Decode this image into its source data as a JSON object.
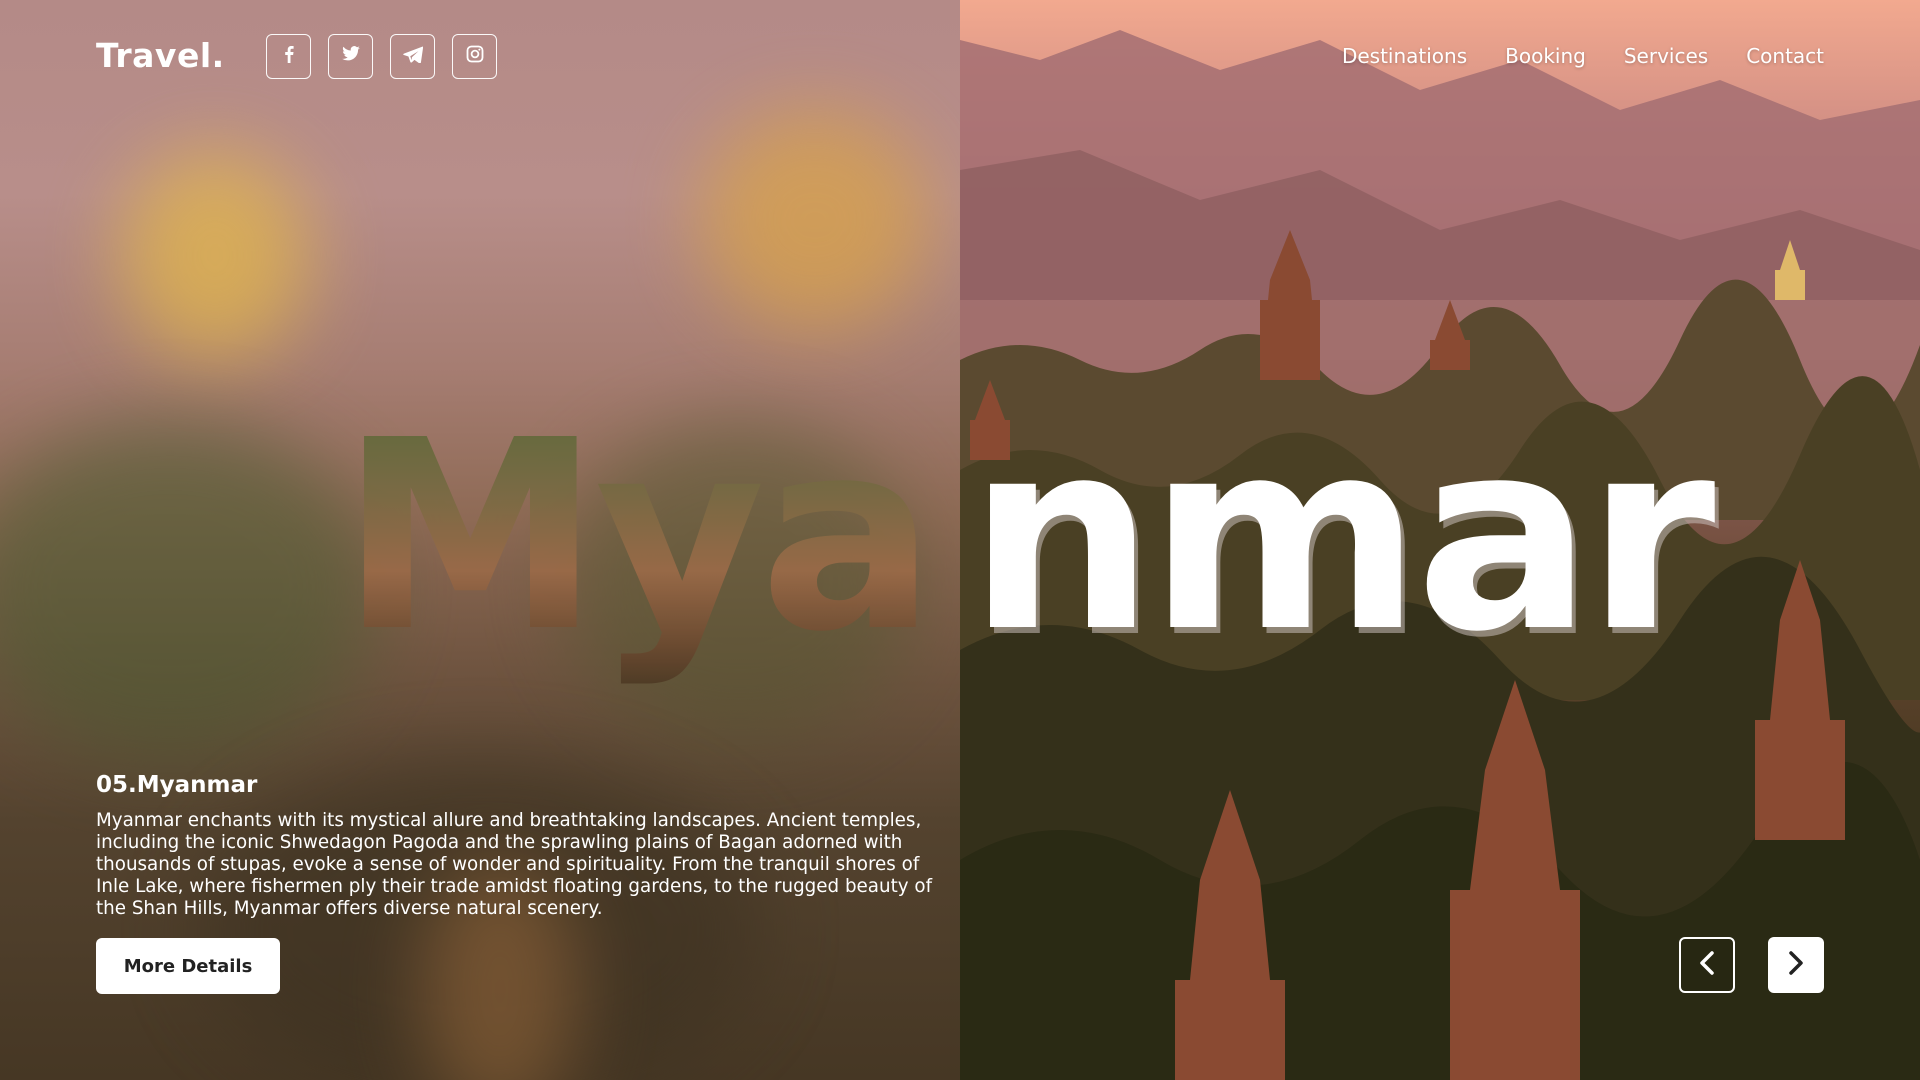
{
  "brand": {
    "logo": "Travel."
  },
  "socials": [
    {
      "name": "facebook",
      "icon": "facebook-icon"
    },
    {
      "name": "twitter",
      "icon": "twitter-icon"
    },
    {
      "name": "telegram",
      "icon": "telegram-icon"
    },
    {
      "name": "instagram",
      "icon": "instagram-icon"
    }
  ],
  "nav": {
    "items": [
      "Destinations",
      "Booking",
      "Services",
      "Contact"
    ]
  },
  "hero": {
    "word_left": "Mya",
    "word_right": "nmar"
  },
  "destination": {
    "title": "05.Myanmar",
    "description": "Myanmar enchants with its mystical allure and breathtaking landscapes. Ancient temples, including the iconic Shwedagon Pagoda and the sprawling plains of Bagan adorned with thousands of stupas, evoke a sense of wonder and spirituality. From the tranquil shores of Inle Lake, where fishermen ply their trade amidst floating gardens, to the rugged beauty of the Shan Hills, Myanmar offers diverse natural scenery.",
    "cta_label": "More Details"
  },
  "carousel": {
    "prev_icon": "chevron-left-icon",
    "next_icon": "chevron-right-icon"
  },
  "colors": {
    "sky_top": "#f2a98f",
    "text": "#ffffff",
    "button_bg": "#ffffff",
    "button_text": "#222222"
  }
}
